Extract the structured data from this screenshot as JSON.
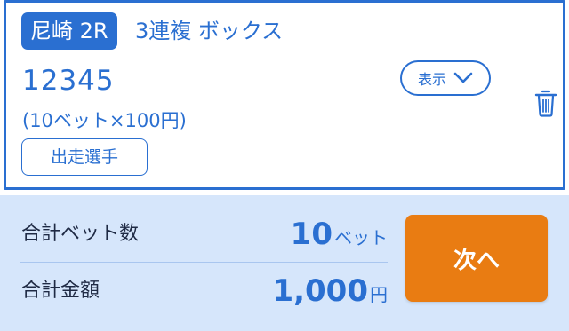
{
  "ticket": {
    "venue_race": "尼崎 2R",
    "bet_type": "3連複 ボックス",
    "numbers": "12345",
    "bet_detail": "(10ベット×100円)",
    "runners_button_label": "出走選手",
    "show_button_label": "表示",
    "accent_color": "#2a6fd1"
  },
  "summary": {
    "bet_count_label": "合計ベット数",
    "bet_count_value": "10",
    "bet_count_unit": "ベット",
    "total_amount_label": "合計金額",
    "total_amount_value": "1,000",
    "total_amount_unit": "円",
    "background_color": "#d6e6fb"
  },
  "next_button": {
    "label": "次へ",
    "color": "#e97c12"
  },
  "icons": {
    "expand": "chevron-down-icon",
    "delete": "trash-icon"
  }
}
